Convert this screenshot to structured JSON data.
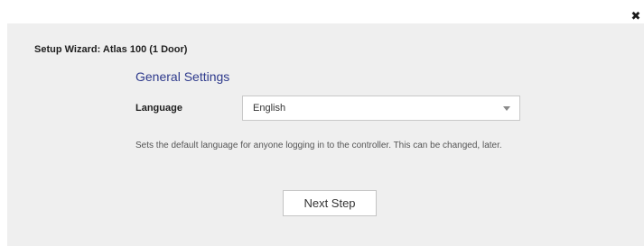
{
  "window": {
    "close_icon": "close-icon",
    "close_glyph": "✖"
  },
  "wizard": {
    "title": "Setup Wizard: Atlas 100 (1 Door)",
    "section_title": "General Settings"
  },
  "language": {
    "label": "Language",
    "selected_value": "English",
    "caret_icon": "chevron-down-icon"
  },
  "help_text": "Sets the default language for anyone logging in to the controller. This can be changed, later.",
  "actions": {
    "next_label": "Next Step"
  },
  "colors": {
    "panel_background": "#efefef",
    "section_title": "#2e3a8c"
  }
}
